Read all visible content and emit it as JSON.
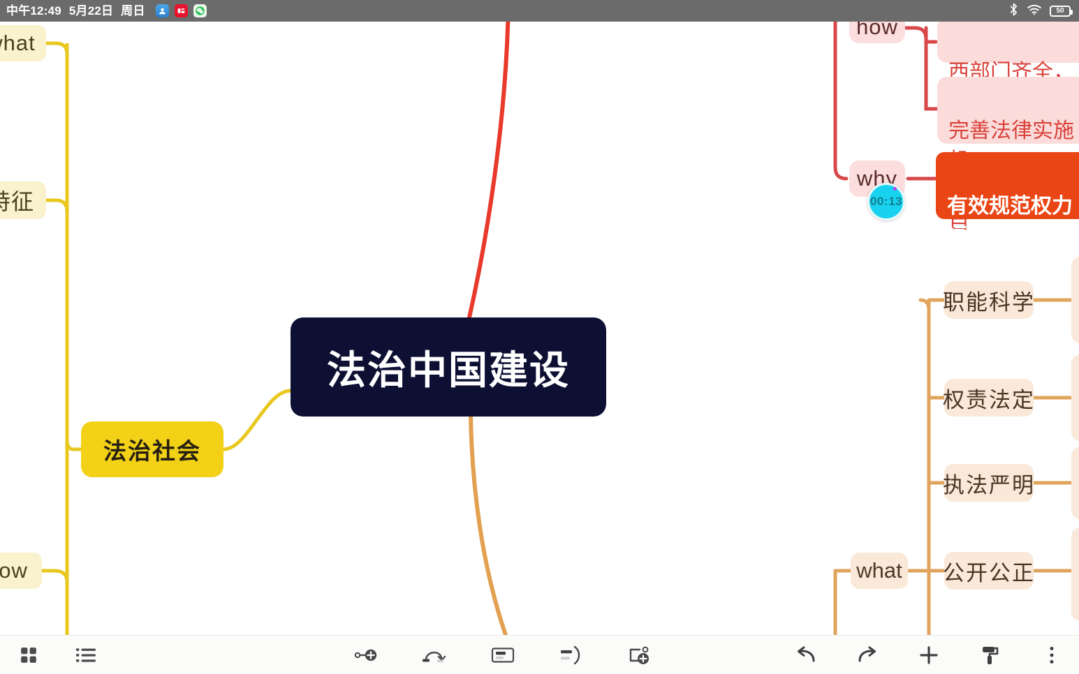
{
  "statusbar": {
    "time": "中午12:49",
    "date": "5月22日",
    "weekday": "周日",
    "app_icons": [
      "blue-app-icon",
      "red-note-app-icon",
      "green-chat-app-icon"
    ],
    "bluetooth_icon": "bluetooth-icon",
    "wifi_icon": "wifi-icon",
    "battery_level": "50"
  },
  "mindmap": {
    "root": {
      "label": "法治中国建设",
      "color": "#0d1033",
      "text_color": "#ffffff"
    },
    "left_branch": {
      "color": "#e8c81f",
      "nodes": [
        {
          "name": "what",
          "label": "what"
        },
        {
          "name": "tezheng",
          "label": "特征"
        },
        {
          "name": "fazhi-shehui",
          "label": "法治社会"
        },
        {
          "name": "how",
          "label": "how"
        }
      ]
    },
    "top_right_branch": {
      "color": "#d8484a",
      "nodes": [
        {
          "name": "how",
          "label": "how"
        },
        {
          "name": "detail-1",
          "label": "西部门齐全，体"
        },
        {
          "name": "detail-2",
          "label": "完善法律实施机\n责，社会公众自"
        },
        {
          "name": "why",
          "label": "why"
        },
        {
          "name": "detail-3",
          "label": "有效规范权力运行\n家治理体系和治"
        }
      ]
    },
    "bottom_right_branch": {
      "color": "#e2a košice"
    },
    "right_branch": {
      "color": "#e0a45c",
      "parent": {
        "name": "what",
        "label": "what"
      },
      "nodes": [
        {
          "name": "zhineng-kexue",
          "label": "职能科学"
        },
        {
          "name": "quanze-fading",
          "label": "权责法定"
        },
        {
          "name": "zhifa-yanming",
          "label": "执法严明"
        },
        {
          "name": "gongkai-gongzheng",
          "label": "公开公正"
        }
      ]
    },
    "timer_badge": {
      "label": "00:13"
    }
  },
  "toolbar": {
    "left": [
      {
        "name": "grid-view-icon",
        "label": "grid-view"
      },
      {
        "name": "outline-list-icon",
        "label": "outline-list"
      }
    ],
    "middle": [
      {
        "name": "add-sibling-node-icon",
        "label": "add-sibling-node"
      },
      {
        "name": "add-relation-arrow-icon",
        "label": "add-relation"
      },
      {
        "name": "add-summary-icon",
        "label": "add-summary"
      },
      {
        "name": "add-bracket-icon",
        "label": "add-bracket"
      },
      {
        "name": "add-child-node-icon",
        "label": "add-child-node"
      }
    ],
    "right": [
      {
        "name": "undo-icon",
        "label": "undo"
      },
      {
        "name": "redo-icon",
        "label": "redo"
      },
      {
        "name": "add-icon",
        "label": "add"
      },
      {
        "name": "format-brush-icon",
        "label": "format-brush"
      },
      {
        "name": "more-options-icon",
        "label": "more"
      }
    ]
  }
}
